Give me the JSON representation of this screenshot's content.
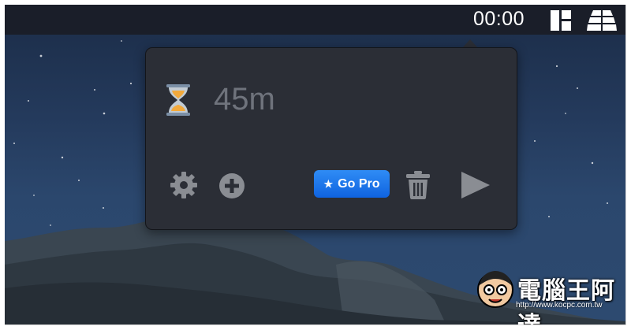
{
  "menubar": {
    "timer_display": "00:00",
    "icons": [
      "layout-icon",
      "app-grid-icon"
    ]
  },
  "popover": {
    "hourglass_icon": "hourglass-icon",
    "duration_value": "45m",
    "settings_icon": "gear-icon",
    "add_icon": "plus-circle-icon",
    "go_pro_label": "Go Pro",
    "go_pro_icon": "star-icon",
    "delete_icon": "trash-icon",
    "start_icon": "play-icon"
  },
  "watermark": {
    "title": "電腦王阿達",
    "url": "http://www.kocpc.com.tw"
  },
  "colors": {
    "menubar": "#1a1e29",
    "popover_bg": "#2b2e36",
    "icon_gray": "#8a8d93",
    "go_pro_blue": "#1a73e8"
  }
}
